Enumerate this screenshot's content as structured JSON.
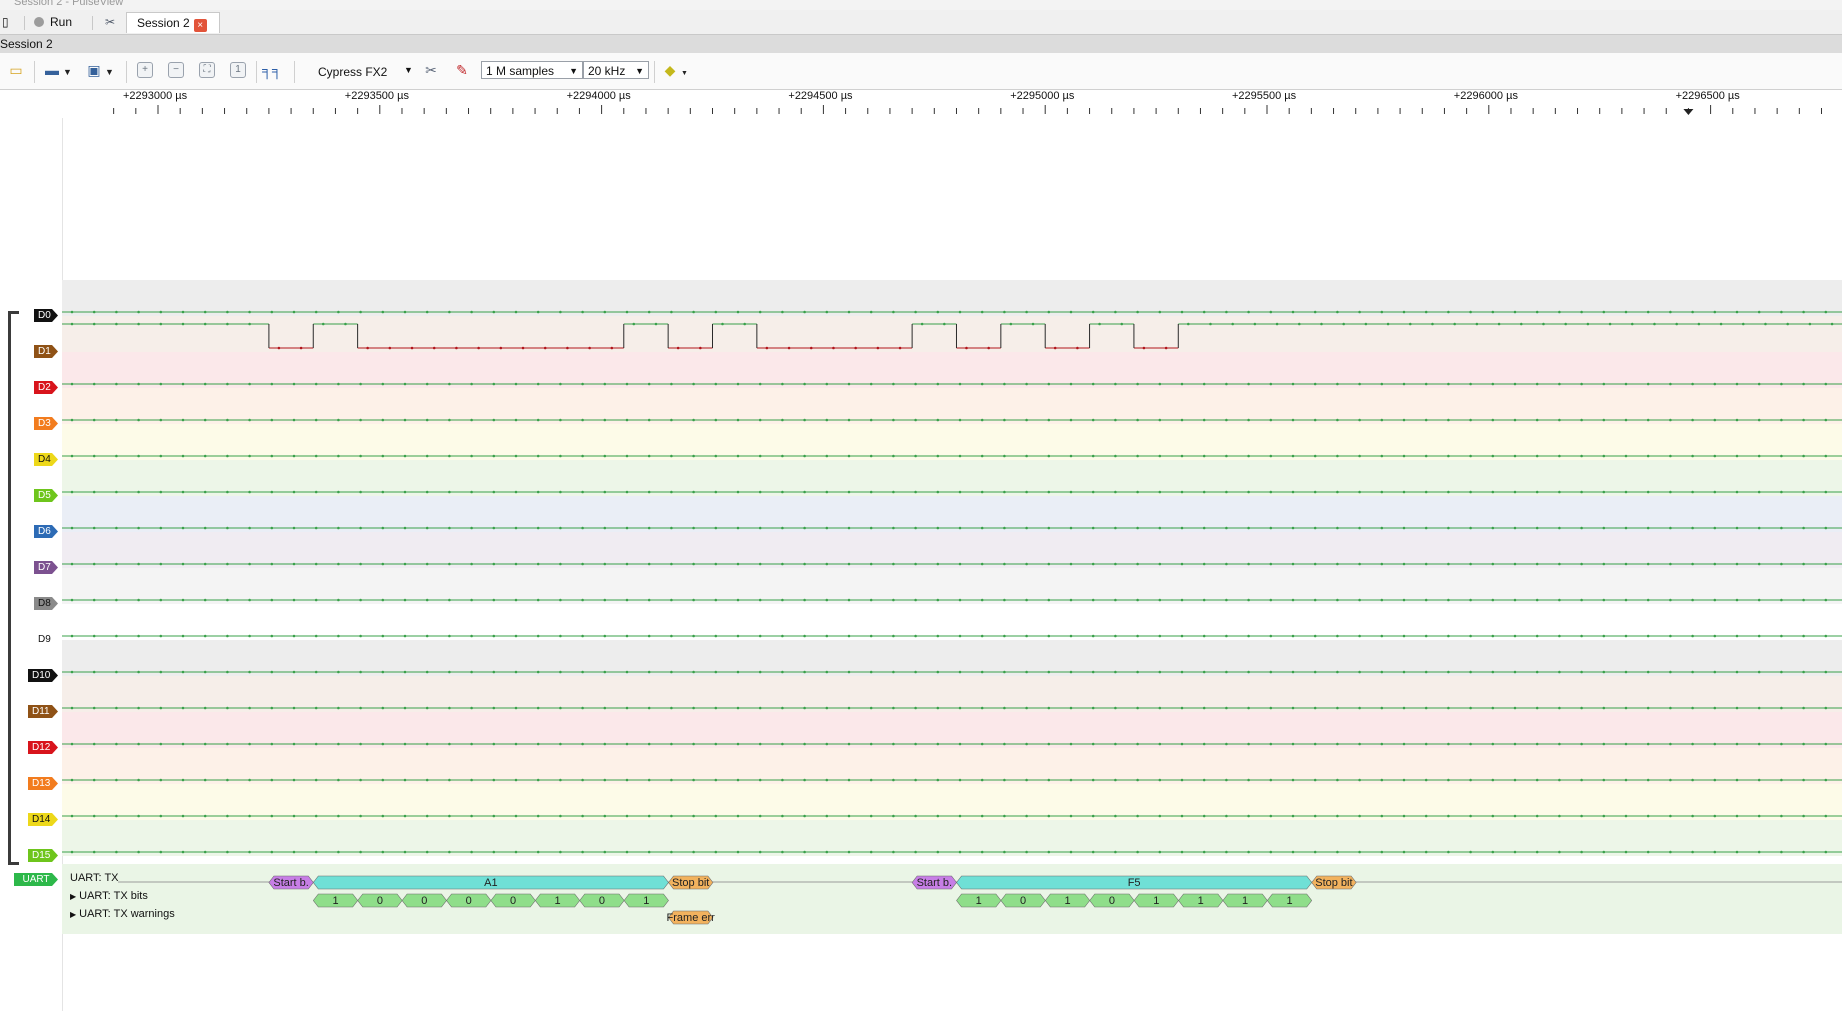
{
  "titlebar": {
    "text": "Session 2 - PulseView"
  },
  "tabs": {
    "run_label": "Run",
    "session_label": "Session 2",
    "close_glyph": "×"
  },
  "session_bar": {
    "label": "Session 2"
  },
  "toolbar": {
    "device": "Cypress FX2",
    "samples": "1 M samples",
    "rate": "20 kHz",
    "icons": [
      "new-session-icon",
      "open-icon",
      "save-icon",
      "zoom-in-icon",
      "zoom-out-icon",
      "zoom-fit-icon",
      "zoom-one-icon",
      "cursors-icon",
      "configure-icon",
      "probes-icon",
      "decoder-icon"
    ]
  },
  "ruler": {
    "labels": [
      "+2293000 µs",
      "+2293500 µs",
      "+2294000 µs",
      "+2294500 µs",
      "+2295000 µs",
      "+2295500 µs",
      "+2296000 µs",
      "+2296500 µs"
    ],
    "label_times_us": [
      2293000,
      2293500,
      2294000,
      2294500,
      2295000,
      2295500,
      2296000,
      2296500
    ]
  },
  "channels": [
    {
      "name": "D0",
      "color": "#111111",
      "bg": "#ededed",
      "text": "#ffffff"
    },
    {
      "name": "D1",
      "color": "#8f5216",
      "bg": "#f6eee9",
      "text": "#ffffff"
    },
    {
      "name": "D2",
      "color": "#d8141c",
      "bg": "#fbe8ea",
      "text": "#ffffff"
    },
    {
      "name": "D3",
      "color": "#f27c1e",
      "bg": "#fdf1e8",
      "text": "#ffffff"
    },
    {
      "name": "D4",
      "color": "#edd81a",
      "bg": "#fdfbe8",
      "text": "#111111"
    },
    {
      "name": "D5",
      "color": "#6ec51c",
      "bg": "#edf6e8",
      "text": "#ffffff"
    },
    {
      "name": "D6",
      "color": "#2d6bb5",
      "bg": "#eaeef6",
      "text": "#ffffff"
    },
    {
      "name": "D7",
      "color": "#7c5190",
      "bg": "#f0ecf2",
      "text": "#ffffff"
    },
    {
      "name": "D8",
      "color": "#8a8a8a",
      "bg": "#f4f4f4",
      "text": "#111111"
    },
    {
      "name": "D9",
      "color": "#ffffff",
      "bg": "#ffffff",
      "text": "#111111"
    },
    {
      "name": "D10",
      "color": "#111111",
      "bg": "#ededed",
      "text": "#ffffff"
    },
    {
      "name": "D11",
      "color": "#8f5216",
      "bg": "#f6eee9",
      "text": "#ffffff"
    },
    {
      "name": "D12",
      "color": "#d8141c",
      "bg": "#fbe8ea",
      "text": "#ffffff"
    },
    {
      "name": "D13",
      "color": "#f27c1e",
      "bg": "#fdf1e8",
      "text": "#ffffff"
    },
    {
      "name": "D14",
      "color": "#edd81a",
      "bg": "#fdfbe8",
      "text": "#111111"
    },
    {
      "name": "D15",
      "color": "#6ec51c",
      "bg": "#edf6e8",
      "text": "#ffffff"
    }
  ],
  "d1_transitions_us": [
    2293250,
    2293350,
    2293450,
    2294050,
    2294150,
    2294250,
    2294350,
    2294700,
    2294800,
    2294900,
    2295000,
    2295100,
    2295200,
    2295300
  ],
  "uart": {
    "label": "UART",
    "rows": [
      "UART: TX",
      "UART: TX bits",
      "UART: TX warnings"
    ],
    "frames": [
      {
        "start_label": "Start b.",
        "byte": "A1",
        "stop_label": "Stop bit",
        "bits": [
          "1",
          "0",
          "0",
          "0",
          "0",
          "1",
          "0",
          "1"
        ],
        "warning": "Frame err"
      },
      {
        "start_label": "Start b.",
        "byte": "F5",
        "stop_label": "Stop bit",
        "bits": [
          "1",
          "0",
          "1",
          "0",
          "1",
          "1",
          "1",
          "1"
        ]
      }
    ]
  },
  "colors": {
    "waveform_high": "#39a04a",
    "waveform_low": "#b1151c",
    "start": "#c77ee6",
    "data": "#6fe0d6",
    "stop": "#f2b25e",
    "bits": "#8fde8a"
  }
}
